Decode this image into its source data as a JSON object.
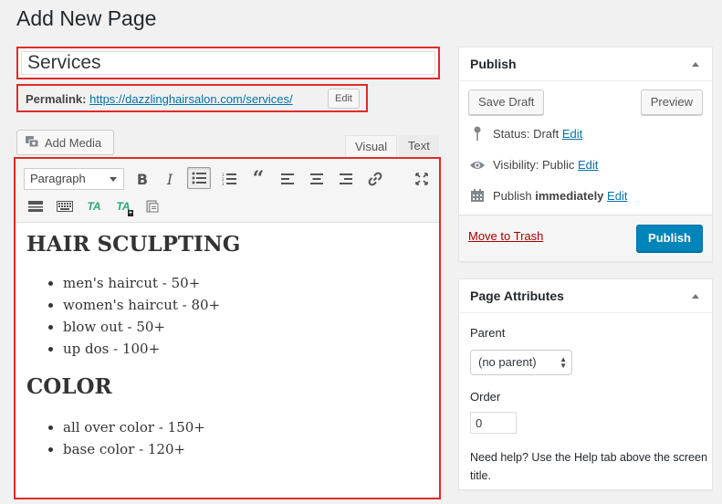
{
  "page": {
    "title": "Add New Page"
  },
  "post": {
    "title": "Services"
  },
  "permalink": {
    "label": "Permalink:",
    "url": "https://dazzlinghairsalon.com/services/",
    "edit_label": "Edit"
  },
  "media": {
    "add_label": "Add Media"
  },
  "editor": {
    "tabs": {
      "visual": "Visual",
      "text": "Text"
    },
    "format": "Paragraph",
    "content": {
      "section1": {
        "heading": "HAIR SCULPTING",
        "items": [
          "men's haircut - 50+",
          "women's haircut - 80+",
          "blow out - 50+",
          "up dos - 100+"
        ]
      },
      "section2": {
        "heading": "COLOR",
        "items": [
          "all over color - 150+",
          "base color - 120+"
        ]
      }
    },
    "toolbar_icons": [
      "bold-icon",
      "italic-icon",
      "bulleted-list-icon",
      "numbered-list-icon",
      "blockquote-icon",
      "align-left-icon",
      "align-center-icon",
      "align-right-icon",
      "link-icon",
      "fullscreen-icon",
      "more-tag-icon",
      "keyboard-icon",
      "ta-icon",
      "ta-plus-icon",
      "paste-text-icon"
    ]
  },
  "publish": {
    "title": "Publish",
    "save_draft": "Save Draft",
    "preview": "Preview",
    "status_label": "Status:",
    "status_value": "Draft",
    "visibility_label": "Visibility:",
    "visibility_value": "Public",
    "schedule_label": "Publish",
    "schedule_value": "immediately",
    "edit": "Edit",
    "trash": "Move to Trash",
    "publish_button": "Publish"
  },
  "attributes": {
    "title": "Page Attributes",
    "parent_label": "Parent",
    "parent_value": "(no parent)",
    "order_label": "Order",
    "order_value": "0",
    "help_text": "Need help? Use the Help tab above the screen title."
  },
  "colors": {
    "accent": "#0085ba",
    "link": "#0073aa",
    "highlight": "#e02b27",
    "trash": "#aa0000"
  }
}
